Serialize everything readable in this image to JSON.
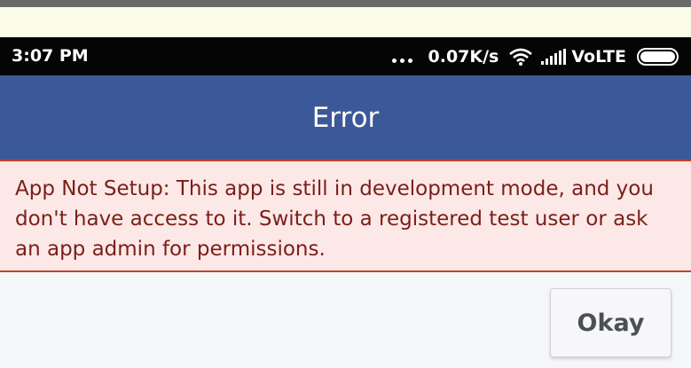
{
  "status_bar": {
    "time": "3:07 PM",
    "network_speed": "0.07K/s",
    "network_type": "VoLTE",
    "icons": [
      "more-dots-icon",
      "wifi-icon",
      "signal-icon",
      "battery-icon"
    ]
  },
  "dialog": {
    "title": "Error",
    "message": "App Not Setup: This app is still in development mode, and you don't have access to it. Switch to a registered test user or ask an app admin for permissions.",
    "okay_label": "Okay"
  },
  "colors": {
    "header": "#3b5998",
    "error_background": "#fde8e8",
    "error_border": "#c44229",
    "error_text": "#7a1f17"
  }
}
